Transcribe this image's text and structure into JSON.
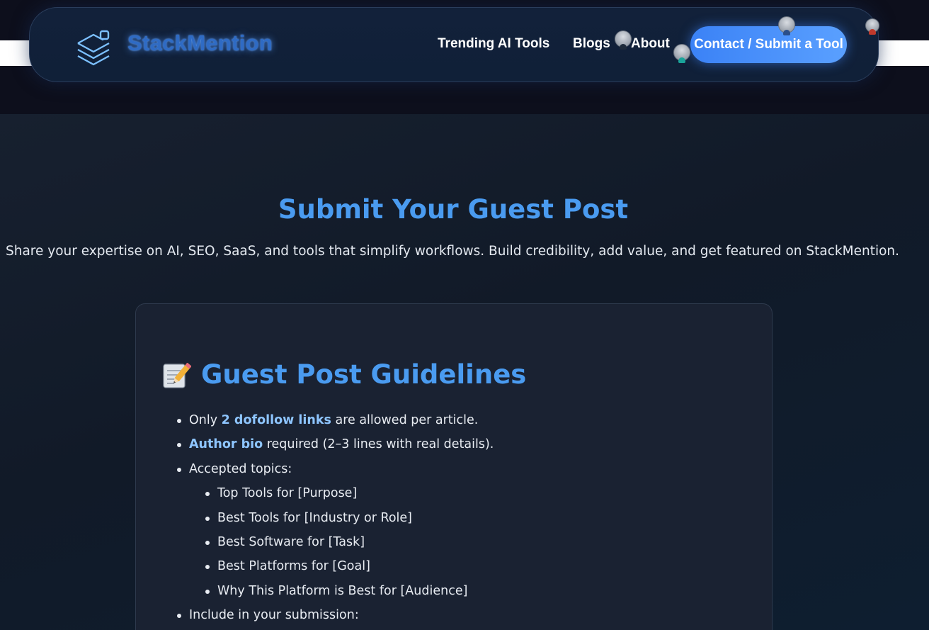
{
  "header": {
    "brand": "StackMention",
    "nav": {
      "trending": "Trending AI Tools",
      "blogs": "Blogs",
      "about": "About"
    },
    "cta": "Contact / Submit a Tool",
    "icons": [
      "stack-layers-icon",
      "avatar"
    ]
  },
  "hero": {
    "title": "Submit Your Guest Post",
    "subtitle": "Share your expertise on AI, SEO, SaaS, and tools that simplify workflows. Build credibility, add value, and get featured on StackMention."
  },
  "guidelines": {
    "icon": "memo-icon",
    "title": "Guest Post Guidelines",
    "item1": {
      "prefix": "Only ",
      "highlight": "2 dofollow links",
      "suffix": " are allowed per article."
    },
    "item2": {
      "highlight": "Author bio",
      "suffix": " required (2–3 lines with real details)."
    },
    "item3": "Accepted topics:",
    "topics": [
      "Top Tools for [Purpose]",
      "Best Tools for [Industry or Role]",
      "Best Software for [Task]",
      "Best Platforms for [Goal]",
      "Why This Platform is Best for [Audience]"
    ],
    "item4": "Include in your submission:"
  },
  "colors": {
    "accent": "#4a9bf0",
    "highlight": "#8ec5ff",
    "button": "#3b82f6",
    "background": "#131c2c"
  }
}
